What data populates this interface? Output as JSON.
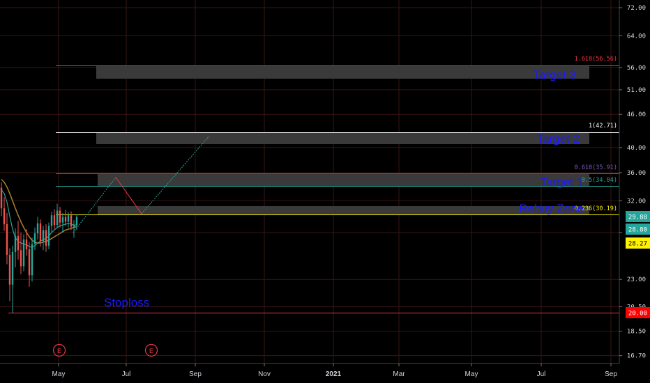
{
  "colors": {
    "background": "#000000",
    "grid": "#3a1414",
    "up_candle": "#26a69a",
    "down_candle": "#ef5350",
    "ma_fast": "#26a69a",
    "ma_slow": "#a07a2a",
    "zone_fill": "#3a3a3a",
    "annotation_text": "#1a1aff"
  },
  "chart_data": {
    "type": "candlestick",
    "title": "",
    "xlabel": "",
    "ylabel": "",
    "y_scale": "log",
    "ylim": [
      16.2,
      75.0
    ],
    "y_ticks": [
      "72.00",
      "64.00",
      "56.00",
      "51.00",
      "46.00",
      "40.00",
      "36.00",
      "32.00",
      "28.00",
      "23.00",
      "20.50",
      "18.50",
      "16.70"
    ],
    "x_ticks": [
      "May",
      "Jul",
      "Sep",
      "Nov",
      "2021",
      "Mar",
      "May",
      "Jul",
      "Sep"
    ],
    "fib_levels": [
      {
        "label": "1.618(56.56)",
        "value": 56.56,
        "color": "#f23645"
      },
      {
        "label": "1(42.71)",
        "value": 42.71,
        "color": "#ffffff"
      },
      {
        "label": "0.618(35.91)",
        "value": 35.91,
        "color": "#7e57c2"
      },
      {
        "label": "0.5(34.04)",
        "value": 34.04,
        "color": "#26a69a"
      },
      {
        "label": "0.236(30.19)",
        "value": 30.19,
        "color": "#fff200"
      },
      {
        "label": "",
        "value": 20.0,
        "color": "#f23645"
      }
    ],
    "zones": [
      {
        "label": "Target 3"
      },
      {
        "label": "Target 2"
      },
      {
        "label": "Target 1"
      },
      {
        "label": "Rebuy Zone"
      },
      {
        "label": "Stoploss"
      }
    ],
    "price_badges": [
      {
        "label": "29.88",
        "value": 29.88,
        "bg": "#26a69a",
        "fg": "#ffffff"
      },
      {
        "label": "28.80",
        "value": 28.8,
        "bg": "#26a69a",
        "fg": "#ffffff"
      },
      {
        "label": "28.27",
        "value": 28.27,
        "bg": "#fff200",
        "fg": "#000000"
      },
      {
        "label": "20.00",
        "value": 20.0,
        "bg": "#ff0000",
        "fg": "#ffffff"
      }
    ],
    "earnings_markers": [
      "E",
      "E"
    ],
    "projection_path": [
      {
        "date": "Apr 2020",
        "value": 28.0
      },
      {
        "date": "Jun 2020",
        "value": 35.3
      },
      {
        "date": "Jul 2020",
        "value": 30.3
      },
      {
        "date": "Sep 2020",
        "value": 42.0
      }
    ],
    "candles": [
      {
        "o": 33.8,
        "h": 34.6,
        "l": 30.0,
        "c": 31.0
      },
      {
        "o": 31.0,
        "h": 32.5,
        "l": 28.2,
        "c": 29.0
      },
      {
        "o": 29.0,
        "h": 30.4,
        "l": 24.5,
        "c": 25.5
      },
      {
        "o": 25.5,
        "h": 26.2,
        "l": 21.0,
        "c": 22.5
      },
      {
        "o": 22.5,
        "h": 26.5,
        "l": 20.0,
        "c": 25.8
      },
      {
        "o": 25.8,
        "h": 28.5,
        "l": 24.2,
        "c": 27.6
      },
      {
        "o": 27.6,
        "h": 29.4,
        "l": 25.0,
        "c": 26.0
      },
      {
        "o": 26.0,
        "h": 28.0,
        "l": 23.5,
        "c": 24.3
      },
      {
        "o": 24.3,
        "h": 27.8,
        "l": 23.8,
        "c": 27.2
      },
      {
        "o": 27.2,
        "h": 28.4,
        "l": 25.4,
        "c": 26.1
      },
      {
        "o": 26.1,
        "h": 26.9,
        "l": 22.3,
        "c": 23.4
      },
      {
        "o": 23.4,
        "h": 27.4,
        "l": 22.8,
        "c": 26.7
      },
      {
        "o": 26.7,
        "h": 28.6,
        "l": 26.0,
        "c": 27.9
      },
      {
        "o": 27.9,
        "h": 29.9,
        "l": 27.2,
        "c": 29.1
      },
      {
        "o": 29.1,
        "h": 29.6,
        "l": 26.4,
        "c": 27.0
      },
      {
        "o": 27.0,
        "h": 28.8,
        "l": 26.0,
        "c": 28.3
      },
      {
        "o": 28.3,
        "h": 29.0,
        "l": 25.8,
        "c": 26.5
      },
      {
        "o": 26.5,
        "h": 29.2,
        "l": 26.1,
        "c": 28.8
      },
      {
        "o": 28.8,
        "h": 30.6,
        "l": 28.1,
        "c": 30.1
      },
      {
        "o": 30.1,
        "h": 30.9,
        "l": 28.4,
        "c": 28.9
      },
      {
        "o": 28.9,
        "h": 31.6,
        "l": 28.5,
        "c": 30.7
      },
      {
        "o": 30.7,
        "h": 31.2,
        "l": 28.6,
        "c": 29.2
      },
      {
        "o": 29.2,
        "h": 30.4,
        "l": 28.0,
        "c": 29.9
      },
      {
        "o": 29.9,
        "h": 30.8,
        "l": 28.8,
        "c": 29.3
      },
      {
        "o": 29.3,
        "h": 30.5,
        "l": 28.6,
        "c": 30.1
      },
      {
        "o": 30.1,
        "h": 30.6,
        "l": 28.3,
        "c": 28.7
      },
      {
        "o": 28.7,
        "h": 29.5,
        "l": 27.4,
        "c": 28.9
      },
      {
        "o": 28.9,
        "h": 30.2,
        "l": 28.3,
        "c": 29.9
      }
    ],
    "ma_fast": [
      33.5,
      33.0,
      31.8,
      30.0,
      28.4,
      27.4,
      27.0,
      26.8,
      26.7,
      26.6,
      26.4,
      26.3,
      26.5,
      26.8,
      27.0,
      27.2,
      27.3,
      27.6,
      28.0,
      28.3,
      28.6,
      28.8,
      28.9,
      29.0,
      29.1,
      29.0,
      28.9,
      28.9
    ],
    "ma_slow": [
      35.0,
      34.6,
      33.9,
      33.0,
      32.0,
      31.0,
      30.1,
      29.3,
      28.6,
      28.0,
      27.5,
      27.1,
      26.9,
      26.8,
      26.8,
      26.9,
      27.0,
      27.1,
      27.3,
      27.5,
      27.7,
      27.9,
      28.1,
      28.3,
      28.4,
      28.5,
      28.6,
      28.7
    ]
  }
}
